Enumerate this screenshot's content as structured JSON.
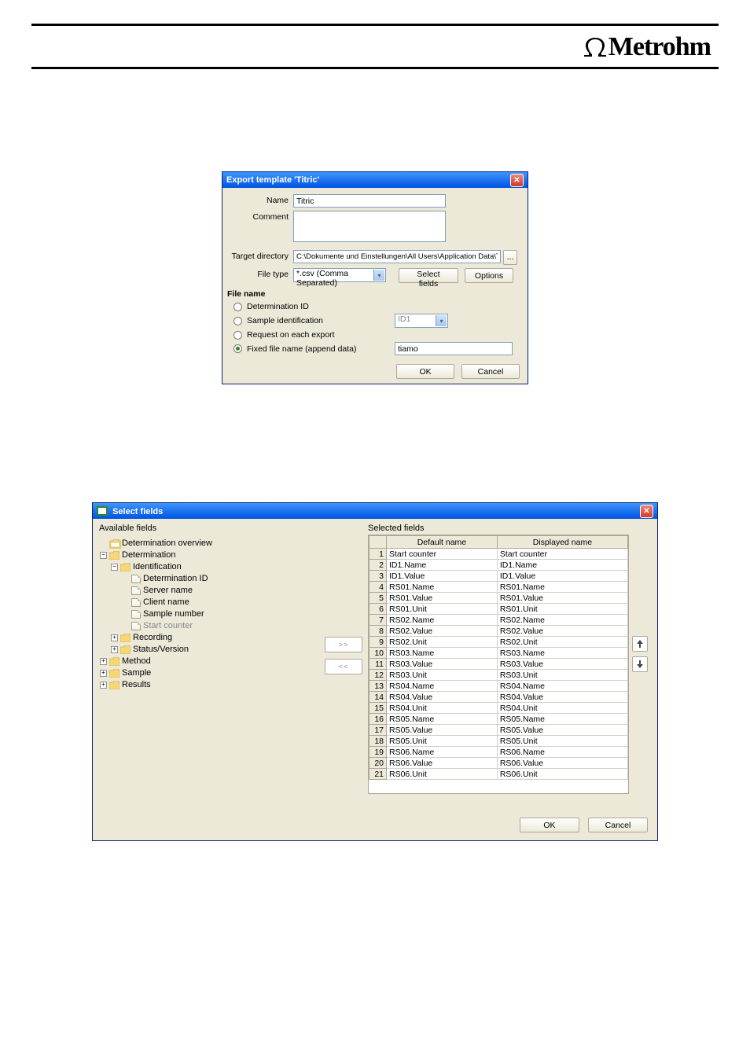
{
  "brand": "Metrohm",
  "dialog1": {
    "title": "Export template 'Titric'",
    "labels": {
      "name": "Name",
      "comment": "Comment",
      "target_dir": "Target directory",
      "file_type": "File type",
      "section": "File name"
    },
    "name_value": "Titric",
    "comment_value": "",
    "target_dir_value": "C:\\Dokumente und Einstellungen\\All Users\\Application Data\\Titric\\reports",
    "browse_btn": "...",
    "file_type_value": "*.csv (Comma Separated)",
    "select_fields_btn": "Select fields",
    "options_btn": "Options",
    "radios": {
      "determination_id": "Determination ID",
      "sample_ident": "Sample identification",
      "request_each": "Request on each export",
      "fixed_file": "Fixed file name (append data)"
    },
    "sample_ident_select": "ID1",
    "fixed_file_value": "tiamo",
    "ok": "OK",
    "cancel": "Cancel"
  },
  "dialog2": {
    "title": "Select fields",
    "avail_label": "Available fields",
    "sel_label": "Selected fields",
    "tree": [
      {
        "lvl": 0,
        "exp": "",
        "type": "folder-root",
        "label": "Determination overview"
      },
      {
        "lvl": 0,
        "exp": "-",
        "type": "folder",
        "label": "Determination"
      },
      {
        "lvl": 1,
        "exp": "-",
        "type": "folder",
        "label": "Identification"
      },
      {
        "lvl": 2,
        "exp": "",
        "type": "leaf",
        "label": "Determination ID"
      },
      {
        "lvl": 2,
        "exp": "",
        "type": "leaf",
        "label": "Server name"
      },
      {
        "lvl": 2,
        "exp": "",
        "type": "leaf",
        "label": "Client name"
      },
      {
        "lvl": 2,
        "exp": "",
        "type": "leaf",
        "label": "Sample number"
      },
      {
        "lvl": 2,
        "exp": "",
        "type": "leaf",
        "label": "Start counter",
        "grey": true
      },
      {
        "lvl": 1,
        "exp": "+",
        "type": "folder",
        "label": "Recording"
      },
      {
        "lvl": 1,
        "exp": "+",
        "type": "folder",
        "label": "Status/Version"
      },
      {
        "lvl": 0,
        "exp": "+",
        "type": "folder",
        "label": "Method"
      },
      {
        "lvl": 0,
        "exp": "+",
        "type": "folder",
        "label": "Sample"
      },
      {
        "lvl": 0,
        "exp": "+",
        "type": "folder",
        "label": "Results"
      }
    ],
    "col_default": "Default name",
    "col_displayed": "Displayed name",
    "rows": [
      {
        "n": 1,
        "def": "Start counter",
        "disp": "Start counter"
      },
      {
        "n": 2,
        "def": "ID1.Name",
        "disp": "ID1.Name"
      },
      {
        "n": 3,
        "def": "ID1.Value",
        "disp": "ID1.Value"
      },
      {
        "n": 4,
        "def": "RS01.Name",
        "disp": "RS01.Name"
      },
      {
        "n": 5,
        "def": "RS01.Value",
        "disp": "RS01.Value"
      },
      {
        "n": 6,
        "def": "RS01.Unit",
        "disp": "RS01.Unit"
      },
      {
        "n": 7,
        "def": "RS02.Name",
        "disp": "RS02.Name"
      },
      {
        "n": 8,
        "def": "RS02.Value",
        "disp": "RS02.Value"
      },
      {
        "n": 9,
        "def": "RS02.Unit",
        "disp": "RS02.Unit"
      },
      {
        "n": 10,
        "def": "RS03.Name",
        "disp": "RS03.Name"
      },
      {
        "n": 11,
        "def": "RS03.Value",
        "disp": "RS03.Value"
      },
      {
        "n": 12,
        "def": "RS03.Unit",
        "disp": "RS03.Unit"
      },
      {
        "n": 13,
        "def": "RS04.Name",
        "disp": "RS04.Name"
      },
      {
        "n": 14,
        "def": "RS04.Value",
        "disp": "RS04.Value"
      },
      {
        "n": 15,
        "def": "RS04.Unit",
        "disp": "RS04.Unit"
      },
      {
        "n": 16,
        "def": "RS05.Name",
        "disp": "RS05.Name"
      },
      {
        "n": 17,
        "def": "RS05.Value",
        "disp": "RS05.Value"
      },
      {
        "n": 18,
        "def": "RS05.Unit",
        "disp": "RS05.Unit"
      },
      {
        "n": 19,
        "def": "RS06.Name",
        "disp": "RS06.Name"
      },
      {
        "n": 20,
        "def": "RS06.Value",
        "disp": "RS06.Value"
      },
      {
        "n": 21,
        "def": "RS06.Unit",
        "disp": "RS06.Unit"
      }
    ],
    "add_btn": ">>",
    "remove_btn": "<<",
    "up_icon": "↑",
    "down_icon": "↓",
    "ok": "OK",
    "cancel": "Cancel"
  }
}
